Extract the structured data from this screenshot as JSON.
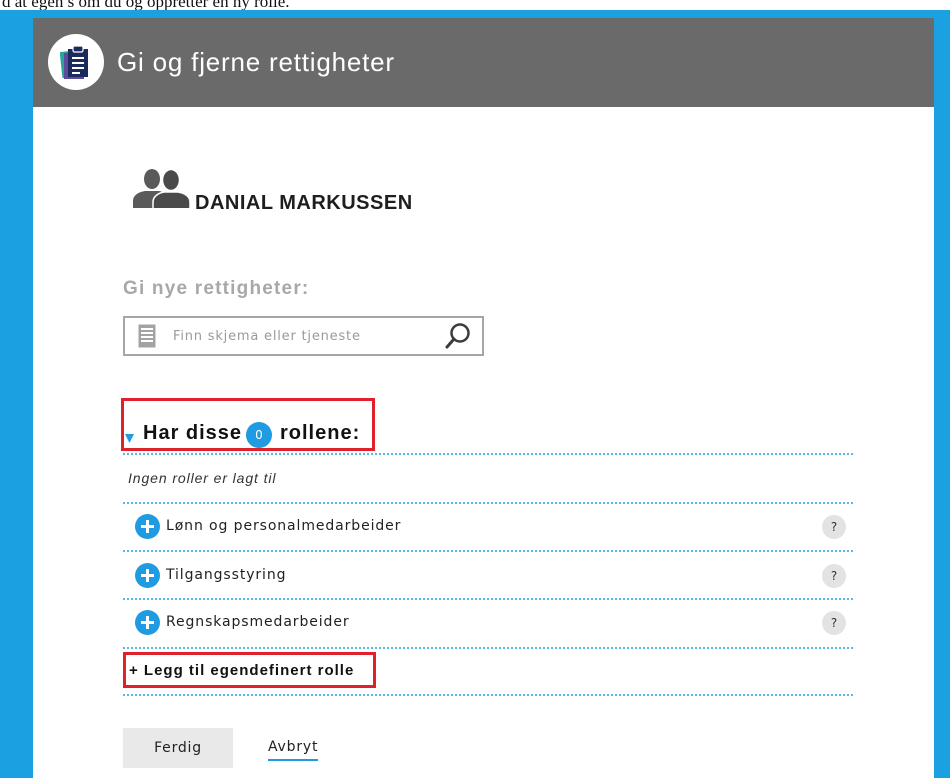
{
  "top_caption": "d at egen s om du og oppretter en ny rolle.",
  "header": {
    "title": "Gi og fjerne rettigheter",
    "logo_icon": "clipboard-icon"
  },
  "user": {
    "icon": "users-icon",
    "name": "DANIAL MARKUSSEN"
  },
  "grant": {
    "label": "Gi nye rettigheter:",
    "search_placeholder": "Finn skjema eller tjeneste",
    "search_value": "",
    "document_icon": "document-icon",
    "search_icon": "search-icon"
  },
  "roles": {
    "toggle_icon": "triangle-down-icon",
    "heading_prefix": "Har disse",
    "count": "0",
    "heading_suffix": "rollene:",
    "empty_text": "Ingen roller er lagt til",
    "suggestions": [
      {
        "label": "Lønn og personalmedarbeider",
        "add_icon": "plus-circle-icon",
        "help_label": "?"
      },
      {
        "label": "Tilgangsstyring",
        "add_icon": "plus-circle-icon",
        "help_label": "?"
      },
      {
        "label": "Regnskapsmedarbeider",
        "add_icon": "plus-circle-icon",
        "help_label": "?"
      }
    ],
    "add_custom_label": "+ Legg til egendefinert rolle"
  },
  "actions": {
    "done_label": "Ferdig",
    "cancel_label": "Avbryt"
  },
  "colors": {
    "frame": "#1ba1e2",
    "header": "#6a6a6a",
    "accent": "#1e9be2",
    "highlight": "#e0202a",
    "muted": "#a8a8a8"
  }
}
